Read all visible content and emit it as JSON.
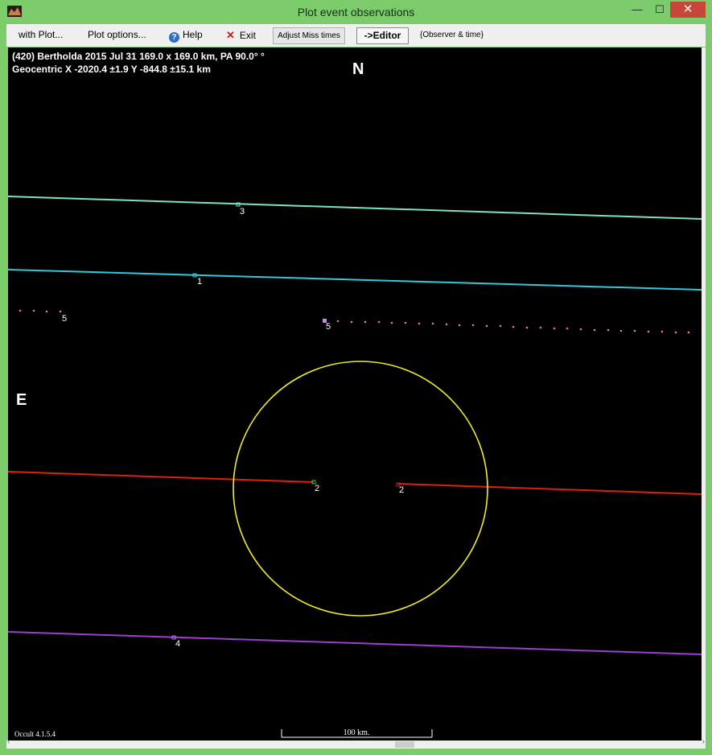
{
  "window": {
    "title": "Plot event observations"
  },
  "titlebar_buttons": {
    "minimize": "—",
    "maximize": "☐",
    "close": "✕"
  },
  "menu": {
    "with_plot": "with Plot...",
    "plot_options": "Plot options...",
    "help": "Help",
    "exit": "Exit",
    "adjust_miss_times": "Adjust Miss times",
    "editor": "->Editor",
    "observer_time": "{Observer & time}"
  },
  "plot": {
    "header_line1": "(420) Bertholda  2015 Jul 31   169.0 x 169.0 km, PA 90.0° °",
    "header_line2": "Geocentric  X  -2020.4 ±1.9  Y  -844.8 ±15.1 km",
    "north": "N",
    "east": "E",
    "version": "Occult 4.1.5.4",
    "scale_label": "100 km."
  },
  "chords": [
    {
      "label": "3",
      "color": "#7fe0c0"
    },
    {
      "label": "1",
      "color": "#33c8d8"
    },
    {
      "label": "5",
      "color": "#e08080"
    },
    {
      "label": "5",
      "color": "#e08080"
    },
    {
      "label": "2",
      "color": "#dd1e10"
    },
    {
      "label": "2",
      "color": "#dd1e10"
    },
    {
      "label": "4",
      "color": "#9a40d0"
    }
  ],
  "ellipse": {
    "color": "#f2ea2a"
  }
}
